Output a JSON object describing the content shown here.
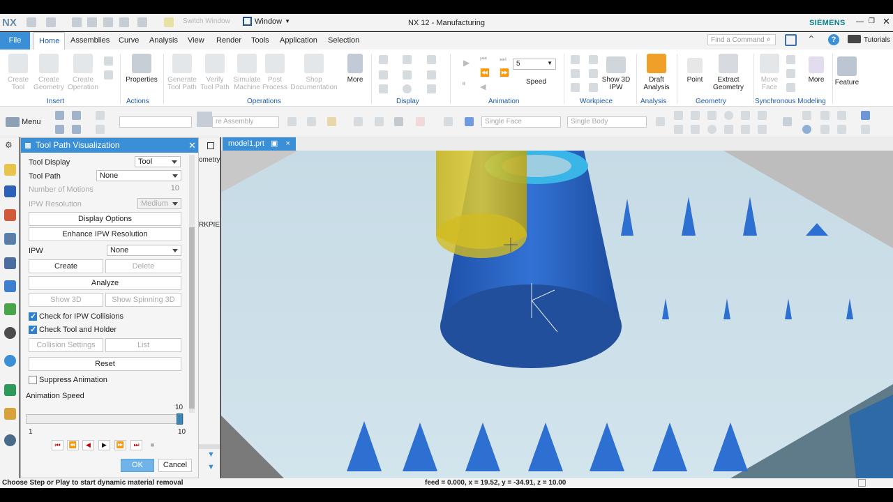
{
  "app": {
    "logo": "NX",
    "window_title": "NX 12 - Manufacturing",
    "brand": "SIEMENS",
    "switch_window": "Switch Window",
    "window_menu": "Window",
    "tutorials": "Tutorials",
    "find_command_placeholder": "Find a Command"
  },
  "menu": {
    "file": "File",
    "tabs": [
      "Home",
      "Assemblies",
      "Curve",
      "Analysis",
      "View",
      "Render",
      "Tools",
      "Application",
      "Selection"
    ]
  },
  "ribbon": {
    "insert": {
      "group": "Insert",
      "create_tool": "Create\nTool",
      "create_geometry": "Create\nGeometry",
      "create_operation": "Create\nOperation"
    },
    "actions": {
      "group": "Actions",
      "properties": "Properties"
    },
    "operations": {
      "group": "Operations",
      "generate": "Generate\nTool Path",
      "verify": "Verify\nTool Path",
      "simulate": "Simulate\nMachine",
      "post": "Post\nProcess",
      "shop": "Shop\nDocumentation",
      "more": "More"
    },
    "display": {
      "group": "Display"
    },
    "animation": {
      "group": "Animation",
      "speed_value": "5",
      "speed_label": "Speed"
    },
    "workpiece": {
      "group": "Workpiece",
      "show3d": "Show 3D\nIPW"
    },
    "analysis": {
      "group": "Analysis",
      "draft": "Draft\nAnalysis"
    },
    "geometry": {
      "group": "Geometry",
      "point": "Point",
      "extract": "Extract\nGeometry"
    },
    "sync": {
      "group": "Synchronous Modeling",
      "move_face": "Move\nFace",
      "more": "More"
    },
    "feature": "Feature"
  },
  "toolbar": {
    "menu": "Menu",
    "assembly_combo": "re Assembly",
    "face_combo": "Single Face",
    "body_combo": "Single Body"
  },
  "dialog": {
    "title": "Tool Path Visualization",
    "tool_display_label": "Tool Display",
    "tool_display_value": "Tool",
    "tool_path_label": "Tool Path",
    "tool_path_value": "None",
    "num_motions_label": "Number of Motions",
    "num_motions_value": "10",
    "ipw_res_label": "IPW Resolution",
    "ipw_res_value": "Medium",
    "display_options": "Display Options",
    "enhance": "Enhance IPW Resolution",
    "ipw_label": "IPW",
    "ipw_value": "None",
    "create": "Create",
    "delete": "Delete",
    "analyze": "Analyze",
    "show3d": "Show 3D",
    "show_spinning": "Show Spinning 3D",
    "check_ipw": "Check for IPW Collisions",
    "check_tool": "Check Tool and Holder",
    "collision_settings": "Collision Settings",
    "list": "List",
    "reset": "Reset",
    "suppress": "Suppress Animation",
    "anim_speed": "Animation Speed",
    "speed_value": "10",
    "speed_min": "1",
    "speed_max": "10",
    "speed_fraction": 1.0,
    "ok": "OK",
    "cancel": "Cancel"
  },
  "nav": {
    "item1": "ometry",
    "item2": "RKPIE"
  },
  "viewport": {
    "tab": "model1.prt"
  },
  "status": {
    "message": "Choose Step or Play to start dynamic material removal",
    "coords": "feed = 0.000, x = 19.52, y = -34.91, z = 10.00"
  },
  "colors": {
    "accent": "#3a8fd6",
    "part_blue": "#2a66c7",
    "tool_yellow": "#d4c000",
    "viewport_bg": "#cfe3ee"
  }
}
